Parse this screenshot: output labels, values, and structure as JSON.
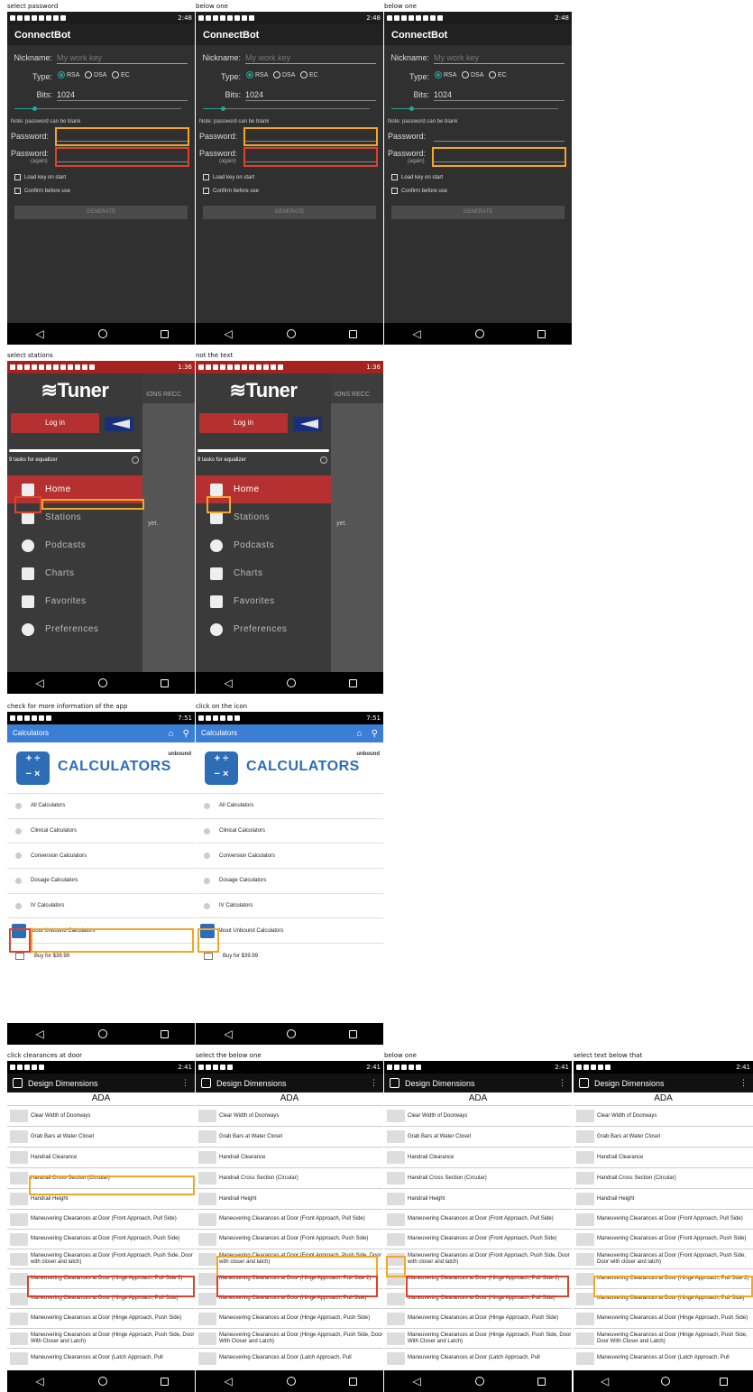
{
  "captions": {
    "p1": "select password",
    "p2": "below one",
    "p3": "below one",
    "p4": "select stations",
    "p5": "not the text",
    "p6": "check for more information of the app",
    "p7": "click on the icon",
    "p8": "click clearances at door",
    "p9": "select the below one",
    "p10": "below one",
    "p11": "select text below that"
  },
  "connectbot": {
    "time": "2:48",
    "app_title": "ConnectBot",
    "nickname_label": "Nickname:",
    "nickname_placeholder": "My work key",
    "type_label": "Type:",
    "type_options": [
      "RSA",
      "DSA",
      "EC"
    ],
    "bits_label": "Bits:",
    "bits_value": "1024",
    "bits_slider_level": 0.12,
    "note": "Note: password can be blank",
    "password_label": "Password:",
    "password_again_label": "Password:",
    "again_sub": "(again)",
    "load_key": "Load key on start",
    "confirm": "Confirm before use",
    "generate": "GENERATE"
  },
  "mytuner": {
    "time": "1:36",
    "logo": "≋Tuner",
    "login": "Log in",
    "progress_level": 1.0,
    "tasks": "9 tasks for equalizer",
    "tabs_text": "IONS   RECC",
    "menu": [
      "Home",
      "Stations",
      "Podcasts",
      "Charts",
      "Favorites",
      "Preferences"
    ],
    "content_fragment": "yet."
  },
  "calculators": {
    "time": "7:51",
    "header": "Calculators",
    "title": "CALCULATORS",
    "brand": "unbound",
    "items": [
      "All Calculators",
      "Clinical Calculators",
      "Conversion Calculators",
      "Dosage Calculators",
      "IV Calculators",
      "About Unbound Calculators",
      "Buy for $39.99"
    ]
  },
  "design": {
    "time": "2:41",
    "header": "Design Dimensions",
    "section": "ADA",
    "rows": [
      "Clear Width of Doorways",
      "Grab Bars at Water Closet",
      "Handrail Clearance",
      "Handrail Cross Section (Circular)",
      "Handrail Height",
      "Maneuvering Clearances at Door (Front Approach, Pull Side)",
      "Maneuvering Clearances at Door (Front Approach, Push Side)",
      "Maneuvering Clearances at Door (Front Approach, Push Side, Door with closer and latch)",
      "Maneuvering Clearances at Door (Hinge Approach, Pull Side 2)",
      "Maneuvering Clearances at Door (Hinge Approach, Pull Side)",
      "Maneuvering Clearances at Door (Hinge Approach, Push Side)",
      "Maneuvering Clearances at Door (Hinge Approach, Push Side, Door With Closer and Latch)",
      "Maneuvering Clearances at Door (Latch Approach, Pull"
    ]
  }
}
